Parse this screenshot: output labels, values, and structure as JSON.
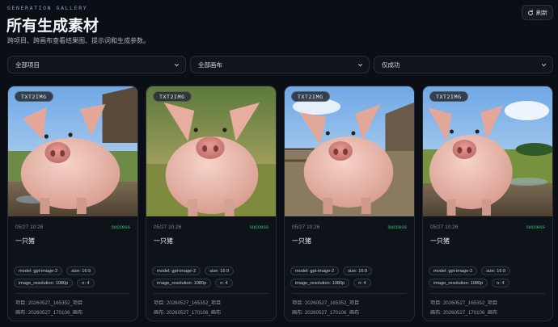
{
  "header": {
    "eyebrow": "GENERATION GALLERY",
    "title": "所有生成素材",
    "subtitle": "跨项目、跨画布查看结果图、提示词和生成参数。",
    "refresh_label": "刷新"
  },
  "filters": {
    "project": "全部项目",
    "canvas": "全部画布",
    "status": "仅成功"
  },
  "colors": {
    "background": "#0b0f15",
    "success": "#35c274",
    "accent": "#6fa8d8"
  },
  "cards": [
    {
      "badge": "TXT2IMG",
      "date": "05/27 10:26",
      "status": "success",
      "prompt": "一只猪",
      "chips": [
        "model: gpt-image-2",
        "size: 16:9",
        "image_resolution: 1080p",
        "n: 4"
      ],
      "project": "项目: 20260527_165352_项目",
      "canvas": "画布: 20260527_170106_画布"
    },
    {
      "badge": "TXT2IMG",
      "date": "05/27 10:26",
      "status": "success",
      "prompt": "一只猪",
      "chips": [
        "model: gpt-image-2",
        "size: 16:9",
        "image_resolution: 1080p",
        "n: 4"
      ],
      "project": "项目: 20260527_165352_项目",
      "canvas": "画布: 20260527_170106_画布"
    },
    {
      "badge": "TXT2IMG",
      "date": "05/27 10:26",
      "status": "success",
      "prompt": "一只猪",
      "chips": [
        "model: gpt-image-2",
        "size: 16:9",
        "image_resolution: 1080p",
        "n: 4"
      ],
      "project": "项目: 20260527_165352_项目",
      "canvas": "画布: 20260527_170106_画布"
    },
    {
      "badge": "TXT2IMG",
      "date": "05/27 10:26",
      "status": "success",
      "prompt": "一只猪",
      "chips": [
        "model: gpt-image-2",
        "size: 16:9",
        "image_resolution: 1080p",
        "n: 4"
      ],
      "project": "项目: 20260527_165352_项目",
      "canvas": "画布: 20260527_170106_画布"
    }
  ]
}
